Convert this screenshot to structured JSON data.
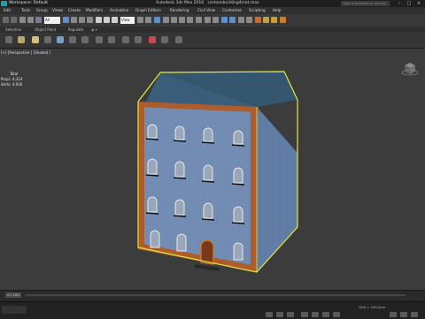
{
  "titlebar": {
    "workspace": "Workspace: Default",
    "app_title": "Autodesk 3ds Max 2016",
    "file_name": "cartoonbuilding4mat.max",
    "search_placeholder": "Type a keyword or phrase"
  },
  "menu": [
    "Edit",
    "Tools",
    "Group",
    "Views",
    "Create",
    "Modifiers",
    "Animation",
    "Graph Editors",
    "Rendering",
    "Civil View",
    "Customize",
    "Scripting",
    "Help"
  ],
  "toolbar": {
    "selection_filter": "All",
    "view_dropdown": "View"
  },
  "ribbon_tabs": [
    "Selection",
    "Object Paint",
    "Populate"
  ],
  "viewport": {
    "label": "[+] [Perspective ] [Shaded ]",
    "stats": {
      "heading": "Total",
      "polys_label": "Polys:",
      "polys_value": "4,324",
      "verts_label": "Verts:",
      "verts_value": "4,936"
    },
    "fps_marker": "FPS"
  },
  "colors": {
    "roof": "#3a5e7a",
    "wall": "#6f8fb6",
    "trim": "#b05c2a",
    "selection_outline": "#e4e83a",
    "door": "#7a3a1a",
    "viewport_bg": "#3c3c3c"
  },
  "timeline": {
    "frame_indicator": "0 / 100"
  },
  "statusbar": {
    "grid": "Grid = 100,0cm"
  }
}
